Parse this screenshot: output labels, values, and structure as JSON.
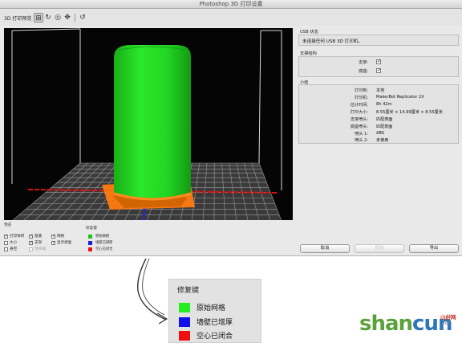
{
  "window": {
    "title": "Photoshop 3D 打印设置"
  },
  "toolbar": {
    "preview_label": "3D 打印预览",
    "buttons": [
      {
        "name": "scene-view",
        "icon": "mesh-view-icon",
        "glyph": "⊞",
        "active": true
      },
      {
        "name": "rotate",
        "icon": "rotate-icon",
        "glyph": "↻",
        "active": false
      },
      {
        "name": "roll",
        "icon": "roll-icon",
        "glyph": "◎",
        "active": false
      },
      {
        "name": "pan",
        "icon": "pan-icon",
        "glyph": "✥",
        "active": false
      },
      {
        "name": "reset",
        "icon": "reset-view-icon",
        "glyph": "↺",
        "active": false
      }
    ]
  },
  "viewport": {
    "background": "#050505",
    "model_color": "#22d822",
    "support_color": "#ff7a10",
    "grid_color": "#9a9a9a",
    "axis_x_color": "#e01010",
    "axis_y_color": "#1a2bdc"
  },
  "controls": {
    "preview_head": "预览",
    "checkboxes": [
      {
        "label": "打印体积",
        "checked": true,
        "disabled": false
      },
      {
        "label": "大小",
        "checked": false,
        "disabled": false
      },
      {
        "label": "悬空",
        "checked": false,
        "disabled": false
      },
      {
        "label": "基底",
        "checked": true,
        "disabled": false
      },
      {
        "label": "支架",
        "checked": true,
        "disabled": false
      },
      {
        "label": "顶点线",
        "checked": false,
        "disabled": true
      },
      {
        "label": "网格",
        "checked": true,
        "disabled": false
      },
      {
        "label": "显示修复",
        "checked": true,
        "disabled": false
      }
    ],
    "repair_head": "修复键",
    "repair_keys": [
      {
        "label": "原始网格",
        "color": "#22c21a"
      },
      {
        "label": "墙壁已增厚",
        "color": "#1a1ae0"
      },
      {
        "label": "空心已闭合",
        "color": "#e81414"
      }
    ]
  },
  "panel": {
    "usb_title": "USB 状态",
    "usb_message": "未连接任何 USB 3D 打印机。",
    "support_title": "支撑结构",
    "support_items": [
      {
        "label": "支架:",
        "checked": true
      },
      {
        "label": "底座:",
        "checked": true
      }
    ],
    "summary_title": "小结",
    "summary": [
      {
        "label": "打印到:",
        "value": "本地"
      },
      {
        "label": "打印机:",
        "value": "MakerBot Replicator 2X"
      },
      {
        "label": "估计时间:",
        "value": "8h 42m"
      },
      {
        "label": "打印大小:",
        "value": "8.55厘米 × 14.99厘米 × 8.55厘米"
      },
      {
        "label": "支架喷头:",
        "value": "匹配表面"
      },
      {
        "label": "底座喷头:",
        "value": "匹配表面"
      },
      {
        "label": "喷头 1:",
        "value": "ABS"
      },
      {
        "label": "喷头 2:",
        "value": "未使用"
      }
    ],
    "buttons": {
      "cancel": "取消",
      "print": "打印",
      "export": "导出"
    }
  },
  "callout": {
    "title": "修复键",
    "rows": [
      {
        "label": "原始网格",
        "color": "#22ee22"
      },
      {
        "label": "墙壁已增厚",
        "color": "#1010ee"
      },
      {
        "label": "空心已闭合",
        "color": "#ee1010"
      }
    ]
  },
  "watermark": {
    "text": "shancun",
    "cn": "山村网",
    "net": ".net"
  }
}
